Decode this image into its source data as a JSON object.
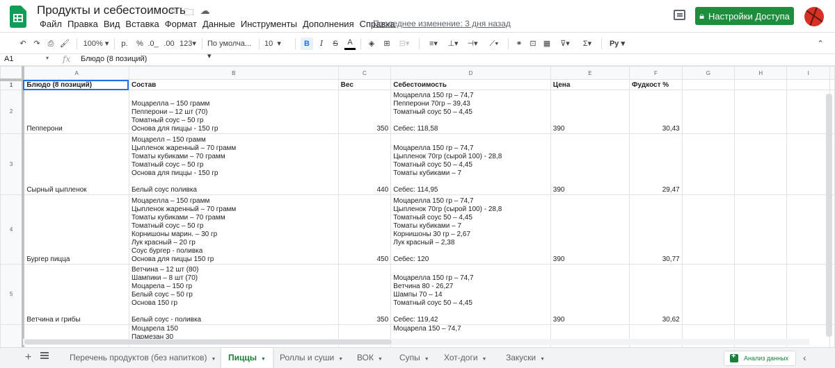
{
  "header": {
    "doc_title": "Продукты и себестоимость",
    "title_icons": [
      "star-icon",
      "folder-move-icon",
      "cloud-icon"
    ],
    "menu": [
      "Файл",
      "Правка",
      "Вид",
      "Вставка",
      "Формат",
      "Данные",
      "Инструменты",
      "Дополнения",
      "Справка"
    ],
    "last_edit": "Последнее изменение: 3 дня назад",
    "share_label": "Настройки Доступа",
    "share_color": "#1e8e3e"
  },
  "toolbar": {
    "zoom": "100%",
    "currency": "р.",
    "percent": "%",
    "dec_less": ".0_",
    "dec_more": ".00",
    "more_formats": "123",
    "font": "По умолча...",
    "font_size": "10",
    "bold": "B",
    "italic": "I",
    "strike": "S",
    "text_color": "A",
    "script_label": "Ру"
  },
  "formula_bar": {
    "cell_ref": "A1",
    "fx": "fx",
    "content": "Блюдо (8 позиций)"
  },
  "grid": {
    "col_headers": [
      "A",
      "B",
      "C",
      "D",
      "E",
      "F",
      "G",
      "H",
      "I"
    ],
    "row_headers": [
      "1",
      "2",
      "3",
      "4",
      "5",
      ""
    ],
    "rows": [
      [
        "Блюдо (8 позиций)",
        "Состав",
        "Вес",
        "Себестоимость",
        "Цена",
        "Фудкост %",
        "",
        "",
        ""
      ],
      [
        "Пепперони",
        "Моцарелла – 150 грамм\nПепперони – 12 шт (70)\nТоматный соус – 50 гр\nОснова для пиццы - 150 гр",
        "350",
        "Моцарелла 150 гр – 74,7\nПепперони 70гр – 39,43\nТоматный соус 50 – 4,45\n\nСебес: 118,58",
        "390",
        "30,43",
        "",
        "",
        ""
      ],
      [
        "Сырный цыпленок",
        "Моцарелл – 150 грамм\nЦыпленок жаренный – 70 грамм\nТоматы кубиками – 70 грамм\nТоматный соус – 50 гр\nОснова для пиццы - 150 гр\n\nБелый соус поливка",
        "440",
        "Моцарелла 150 гр – 74,7\nЦыпленок 70гр (сырой 100) - 28,8\nТоматный соус 50 – 4,45\nТоматы кубиками – 7\n\nСебес: 114,95",
        "390",
        "29,47",
        "",
        "",
        ""
      ],
      [
        "Бургер пицца",
        "Моцарелла – 150 грамм\nЦыпленок жаренный – 70 грамм\nТоматы кубиками – 70 грамм\nТоматный соус – 50 гр\nКорнишоны марин. – 30 гр\nЛук красный – 20 гр\nСоус бургер - поливка\nОснова для пиццы 150 гр",
        "450",
        "Моцарелла 150 гр – 74,7\nЦыпленок 70гр (сырой 100) - 28,8\nТоматный соус 50 – 4,45\nТоматы кубиками – 7\nКорнишоны 30 гр – 2,67\nЛук красный – 2,38\n\nСебес: 120",
        "390",
        "30,77",
        "",
        "",
        ""
      ],
      [
        "Ветчина и грибы",
        "Ветчина – 12 шт (80)\nШампики – 8 шт (70)\nМоцарела – 150 гр\nБелый соус – 50 гр\nОснова 150 гр\n\nБелый соус - поливка",
        "350",
        "Моцарелла 150 гр – 74,7\nВетчина 80 - 26,27\nШампы 70 – 14\nТоматный соус 50 – 4,45\n\nСебес: 119,42\n",
        "390",
        "30,62",
        "",
        "",
        ""
      ],
      [
        "",
        "Моцарела 150\nПармезан 30",
        "",
        "Моцарела 150 – 74,7",
        "",
        "",
        "",
        "",
        ""
      ]
    ]
  },
  "tabs": {
    "sheets": [
      {
        "label": "Перечень продуктов (без напитков)",
        "active": false
      },
      {
        "label": "Пиццы",
        "active": true
      },
      {
        "label": "Роллы и суши",
        "active": false
      },
      {
        "label": "ВОК",
        "active": false
      },
      {
        "label": "Супы",
        "active": false
      },
      {
        "label": "Хот-доги",
        "active": false
      },
      {
        "label": "Закуски",
        "active": false
      }
    ],
    "explore_label": "Анализ данных",
    "active_color": "#188038"
  }
}
